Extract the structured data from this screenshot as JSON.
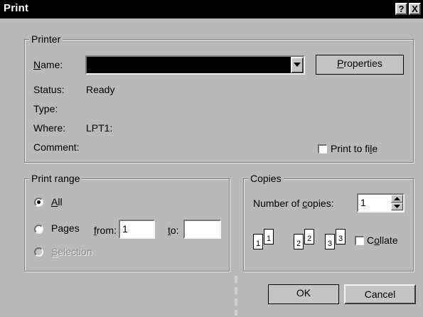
{
  "title": "Print",
  "titlebar_buttons": {
    "help": "?",
    "close": "X"
  },
  "printer": {
    "legend": "Printer",
    "name_label_prefix": "N",
    "name_label_rest": "ame:",
    "name_value": "",
    "properties_prefix": "P",
    "properties_rest": "roperties",
    "status_label": "Status:",
    "status_value": "Ready",
    "type_label": "Type:",
    "type_value": "",
    "where_label": "Where:",
    "where_value": "LPT1:",
    "comment_label": "Comment:",
    "comment_value": "",
    "print_to_file_prefix": "Print to fi",
    "print_to_file_u": "l",
    "print_to_file_rest": "e",
    "print_to_file_checked": false
  },
  "print_range": {
    "legend": "Print range",
    "all_u": "A",
    "all_rest": "ll",
    "pages_prefix": "Pa",
    "pages_u": "g",
    "pages_rest": "es",
    "from_u": "f",
    "from_rest": "rom:",
    "from_value": "1",
    "to_u": "t",
    "to_rest": "o:",
    "to_value": "",
    "selection_u": "S",
    "selection_rest": "election",
    "selected": "all"
  },
  "copies": {
    "legend": "Copies",
    "number_prefix": "Number of ",
    "number_u": "c",
    "number_rest": "opies:",
    "number_value": "1",
    "collate_prefix": "C",
    "collate_u": "o",
    "collate_rest": "llate",
    "collate_checked": false,
    "icon_pages": [
      "1",
      "1",
      "2",
      "2",
      "3",
      "3"
    ]
  },
  "buttons": {
    "ok": "OK",
    "cancel": "Cancel"
  }
}
